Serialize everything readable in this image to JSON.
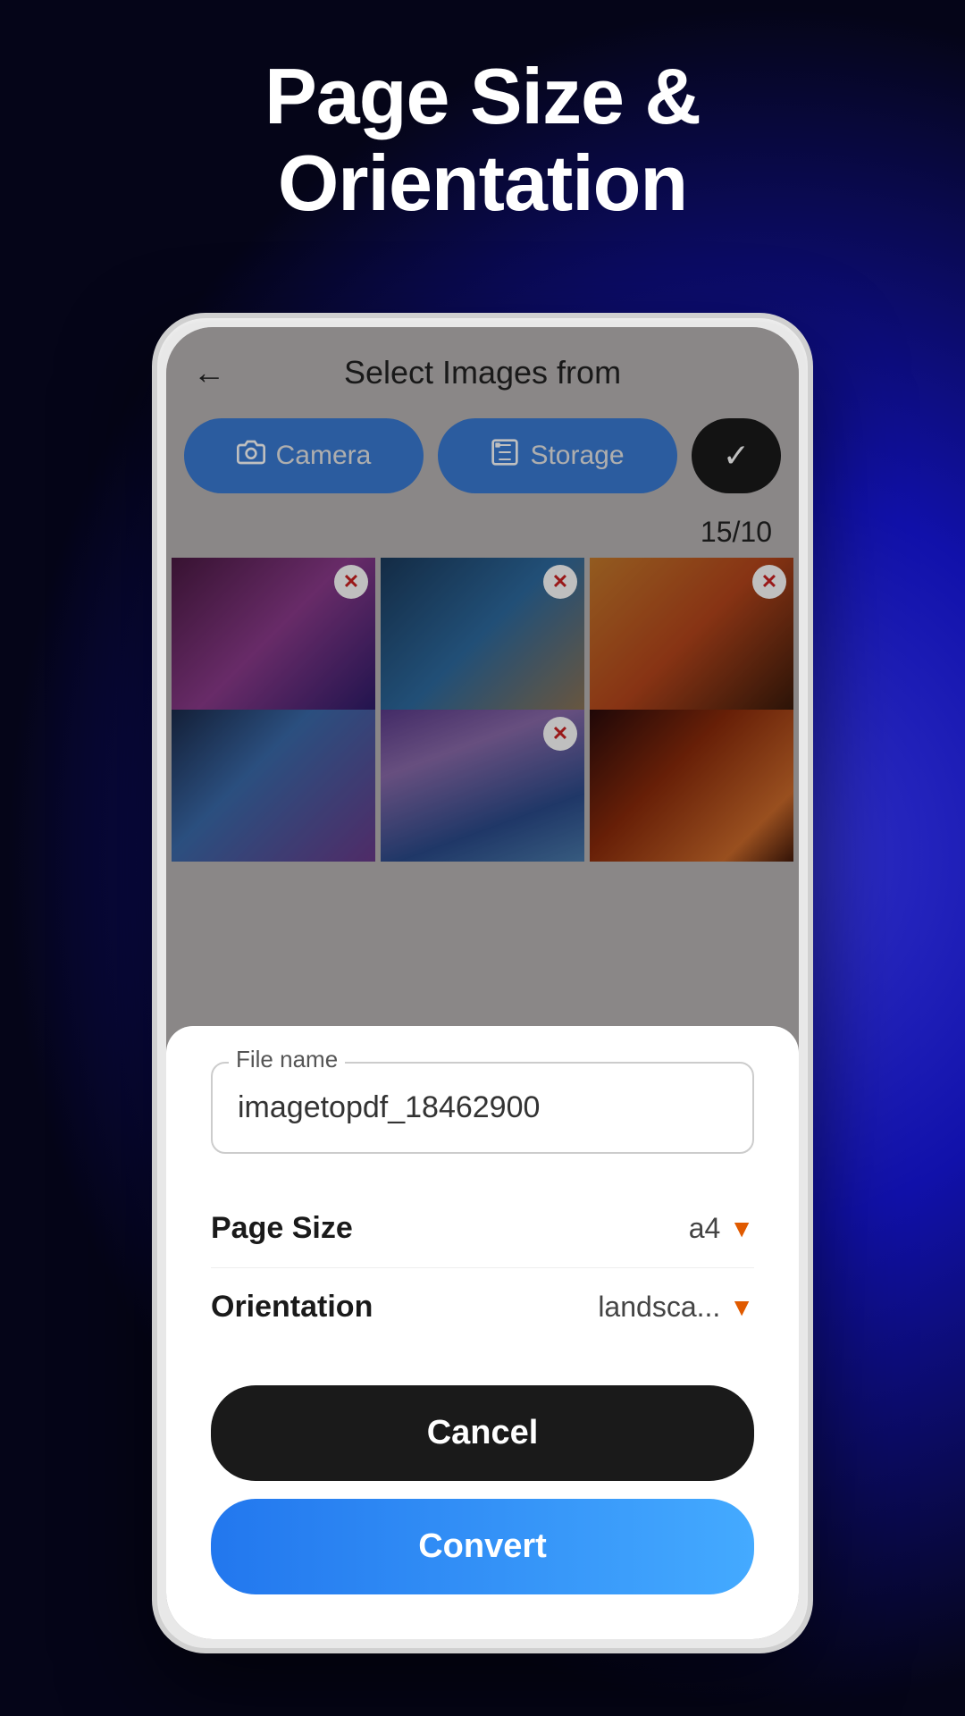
{
  "background": {
    "gradient": "radial from right blue"
  },
  "title": {
    "line1": "Page Size &",
    "line2": "Orientation"
  },
  "app": {
    "header": {
      "back_label": "←",
      "title": "Select Images from"
    },
    "buttons": {
      "camera_label": "Camera",
      "storage_label": "Storage",
      "check_icon": "✓"
    },
    "counter": "15/10",
    "remove_icon": "✕"
  },
  "modal": {
    "file_name_legend": "File name",
    "file_name_value": "imagetopdf_18462900",
    "page_size_label": "Page Size",
    "page_size_value": "a4",
    "orientation_label": "Orientation",
    "orientation_value": "landsca...",
    "cancel_label": "Cancel",
    "convert_label": "Convert"
  },
  "images": {
    "row1": [
      {
        "id": "img1",
        "alt": "purple mountain sunset"
      },
      {
        "id": "img2",
        "alt": "mountain lake"
      },
      {
        "id": "img3",
        "alt": "canyon sunset"
      }
    ],
    "row2": [
      {
        "id": "img4",
        "alt": "blue mountain"
      },
      {
        "id": "img5",
        "alt": "purple hills"
      },
      {
        "id": "img6",
        "alt": "red canyon"
      }
    ]
  }
}
